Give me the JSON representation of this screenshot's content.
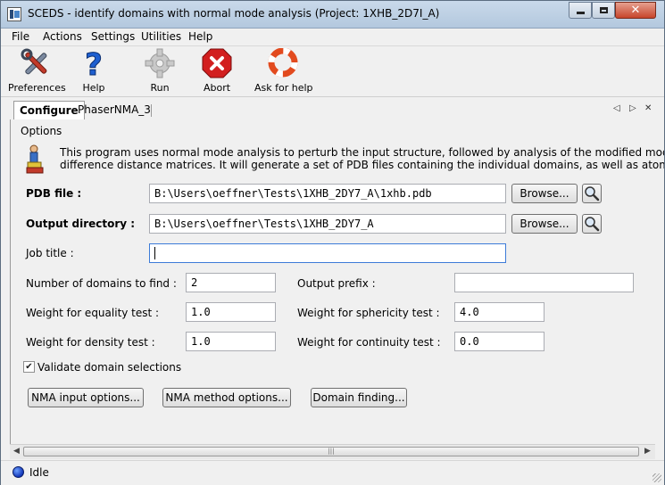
{
  "window": {
    "title": "SCEDS - identify domains with normal mode analysis (Project: 1XHB_2D7I_A)",
    "close_glyph": "✕"
  },
  "menu": [
    "File",
    "Actions",
    "Settings",
    "Utilities",
    "Help"
  ],
  "toolbar": {
    "preferences": "Preferences",
    "help": "Help",
    "run": "Run",
    "abort": "Abort",
    "ask_for_help": "Ask for help"
  },
  "tabs": {
    "configure": "Configure",
    "phasernma": "PhaserNMA_3"
  },
  "options": {
    "heading": "Options",
    "intro_line1": "This program uses normal mode analysis to perturb the input structure, followed by analysis of the modified models using",
    "intro_line2": "difference distance matrices.  It will generate a set of PDB files containing the individual domains, as well as atom selections"
  },
  "form": {
    "pdb_file_label": "PDB file :",
    "pdb_file_value": "B:\\Users\\oeffner\\Tests\\1XHB_2DY7_A\\1xhb.pdb",
    "output_dir_label": "Output directory :",
    "output_dir_value": "B:\\Users\\oeffner\\Tests\\1XHB_2DY7_A",
    "browse_label": "Browse...",
    "job_title_label": "Job title :",
    "job_title_value": "",
    "num_domains_label": "Number of domains to find :",
    "num_domains_value": "2",
    "output_prefix_label": "Output prefix :",
    "output_prefix_value": "",
    "weight_equality_label": "Weight for equality test :",
    "weight_equality_value": "1.0",
    "weight_sphericity_label": "Weight for sphericity test :",
    "weight_sphericity_value": "4.0",
    "weight_density_label": "Weight for density test :",
    "weight_density_value": "1.0",
    "weight_continuity_label": "Weight for continuity test :",
    "weight_continuity_value": "0.0",
    "validate_label": "Validate domain selections",
    "validate_checked": true,
    "nma_input_label": "NMA input options...",
    "nma_method_label": "NMA method options...",
    "domain_finding_label": "Domain finding..."
  },
  "status": {
    "text": "Idle"
  },
  "colors": {
    "accent_focus": "#3d7bd8",
    "abort_red": "#d21f1f",
    "help_blue": "#1e5fd0",
    "status_blue": "#1236b8"
  },
  "icons": {
    "preferences": "tools-icon",
    "help": "question-mark-icon",
    "run": "gear-icon",
    "abort": "stop-x-icon",
    "ask_for_help": "lifebuoy-icon",
    "browse_search": "magnifier-icon",
    "program": "program-figure-icon"
  }
}
